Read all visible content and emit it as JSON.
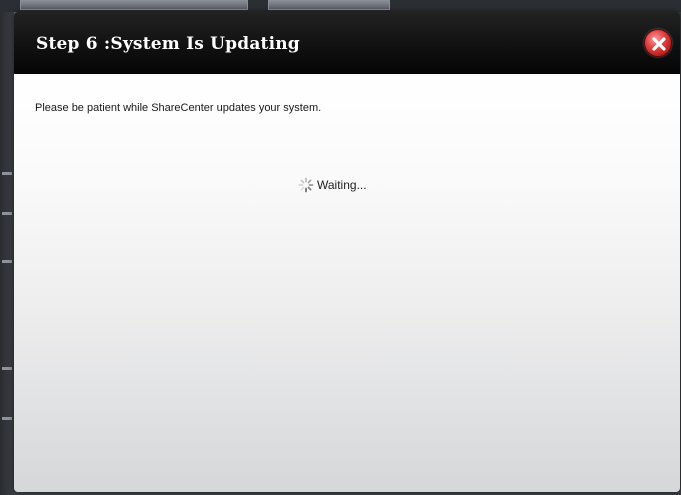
{
  "dialog": {
    "title": "Step 6 :System Is Updating",
    "message": "Please be patient while ShareCenter updates your system.",
    "status_text": "Waiting...",
    "close_icon": "close-icon",
    "spinner_icon": "loading-spinner-icon"
  },
  "colors": {
    "header_bg": "#111111",
    "title_text": "#ffffff",
    "close_button": "#d13232",
    "body_top": "#ffffff",
    "body_bottom": "#d6d7d9"
  }
}
